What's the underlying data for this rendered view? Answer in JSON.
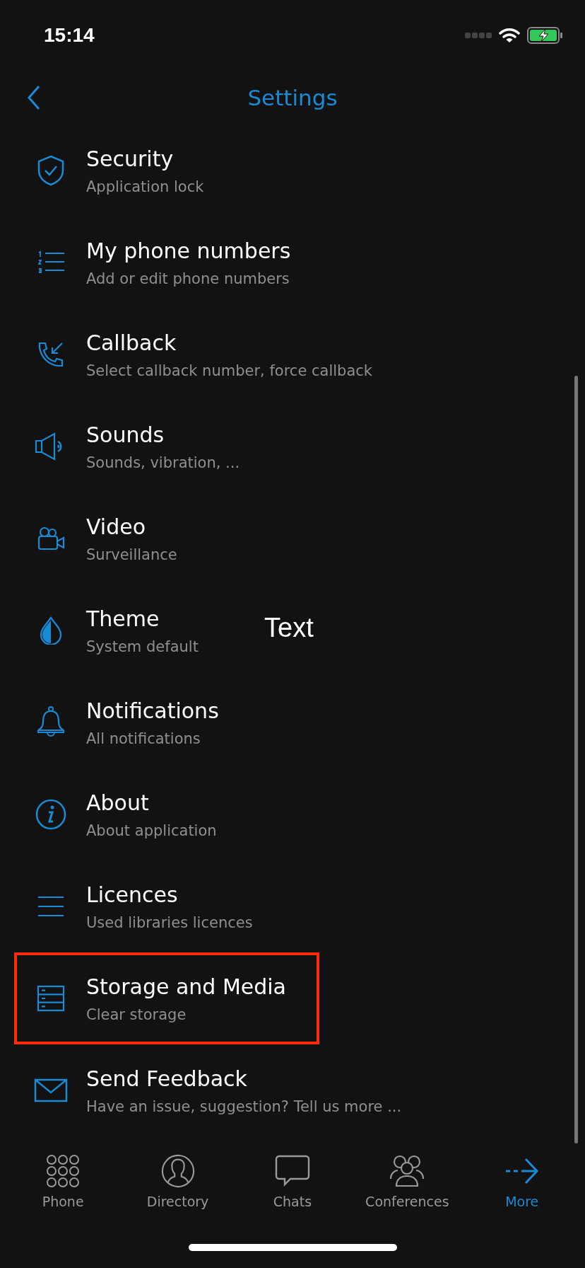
{
  "status_bar": {
    "time": "15:14"
  },
  "nav": {
    "title": "Settings"
  },
  "items": [
    {
      "title": "Security",
      "subtitle": "Application lock",
      "highlighted": false
    },
    {
      "title": "My phone numbers",
      "subtitle": "Add or edit phone numbers",
      "highlighted": false
    },
    {
      "title": "Callback",
      "subtitle": "Select callback number, force callback",
      "highlighted": false
    },
    {
      "title": "Sounds",
      "subtitle": "Sounds, vibration, ...",
      "highlighted": false
    },
    {
      "title": "Video",
      "subtitle": "Surveillance",
      "highlighted": false
    },
    {
      "title": "Theme",
      "subtitle": "System default",
      "highlighted": false
    },
    {
      "title": "Notifications",
      "subtitle": "All notifications",
      "highlighted": false
    },
    {
      "title": "About",
      "subtitle": "About application",
      "highlighted": false
    },
    {
      "title": "Licences",
      "subtitle": "Used libraries licences",
      "highlighted": false
    },
    {
      "title": "Storage and Media",
      "subtitle": "Clear storage",
      "highlighted": true
    },
    {
      "title": "Send Feedback",
      "subtitle": "Have an issue, suggestion? Tell us more ...",
      "highlighted": false
    }
  ],
  "overlay_label": "Text",
  "tabs": [
    {
      "label": "Phone",
      "selected": false
    },
    {
      "label": "Directory",
      "selected": false
    },
    {
      "label": "Chats",
      "selected": false
    },
    {
      "label": "Conferences",
      "selected": false
    },
    {
      "label": "More",
      "selected": true
    }
  ]
}
